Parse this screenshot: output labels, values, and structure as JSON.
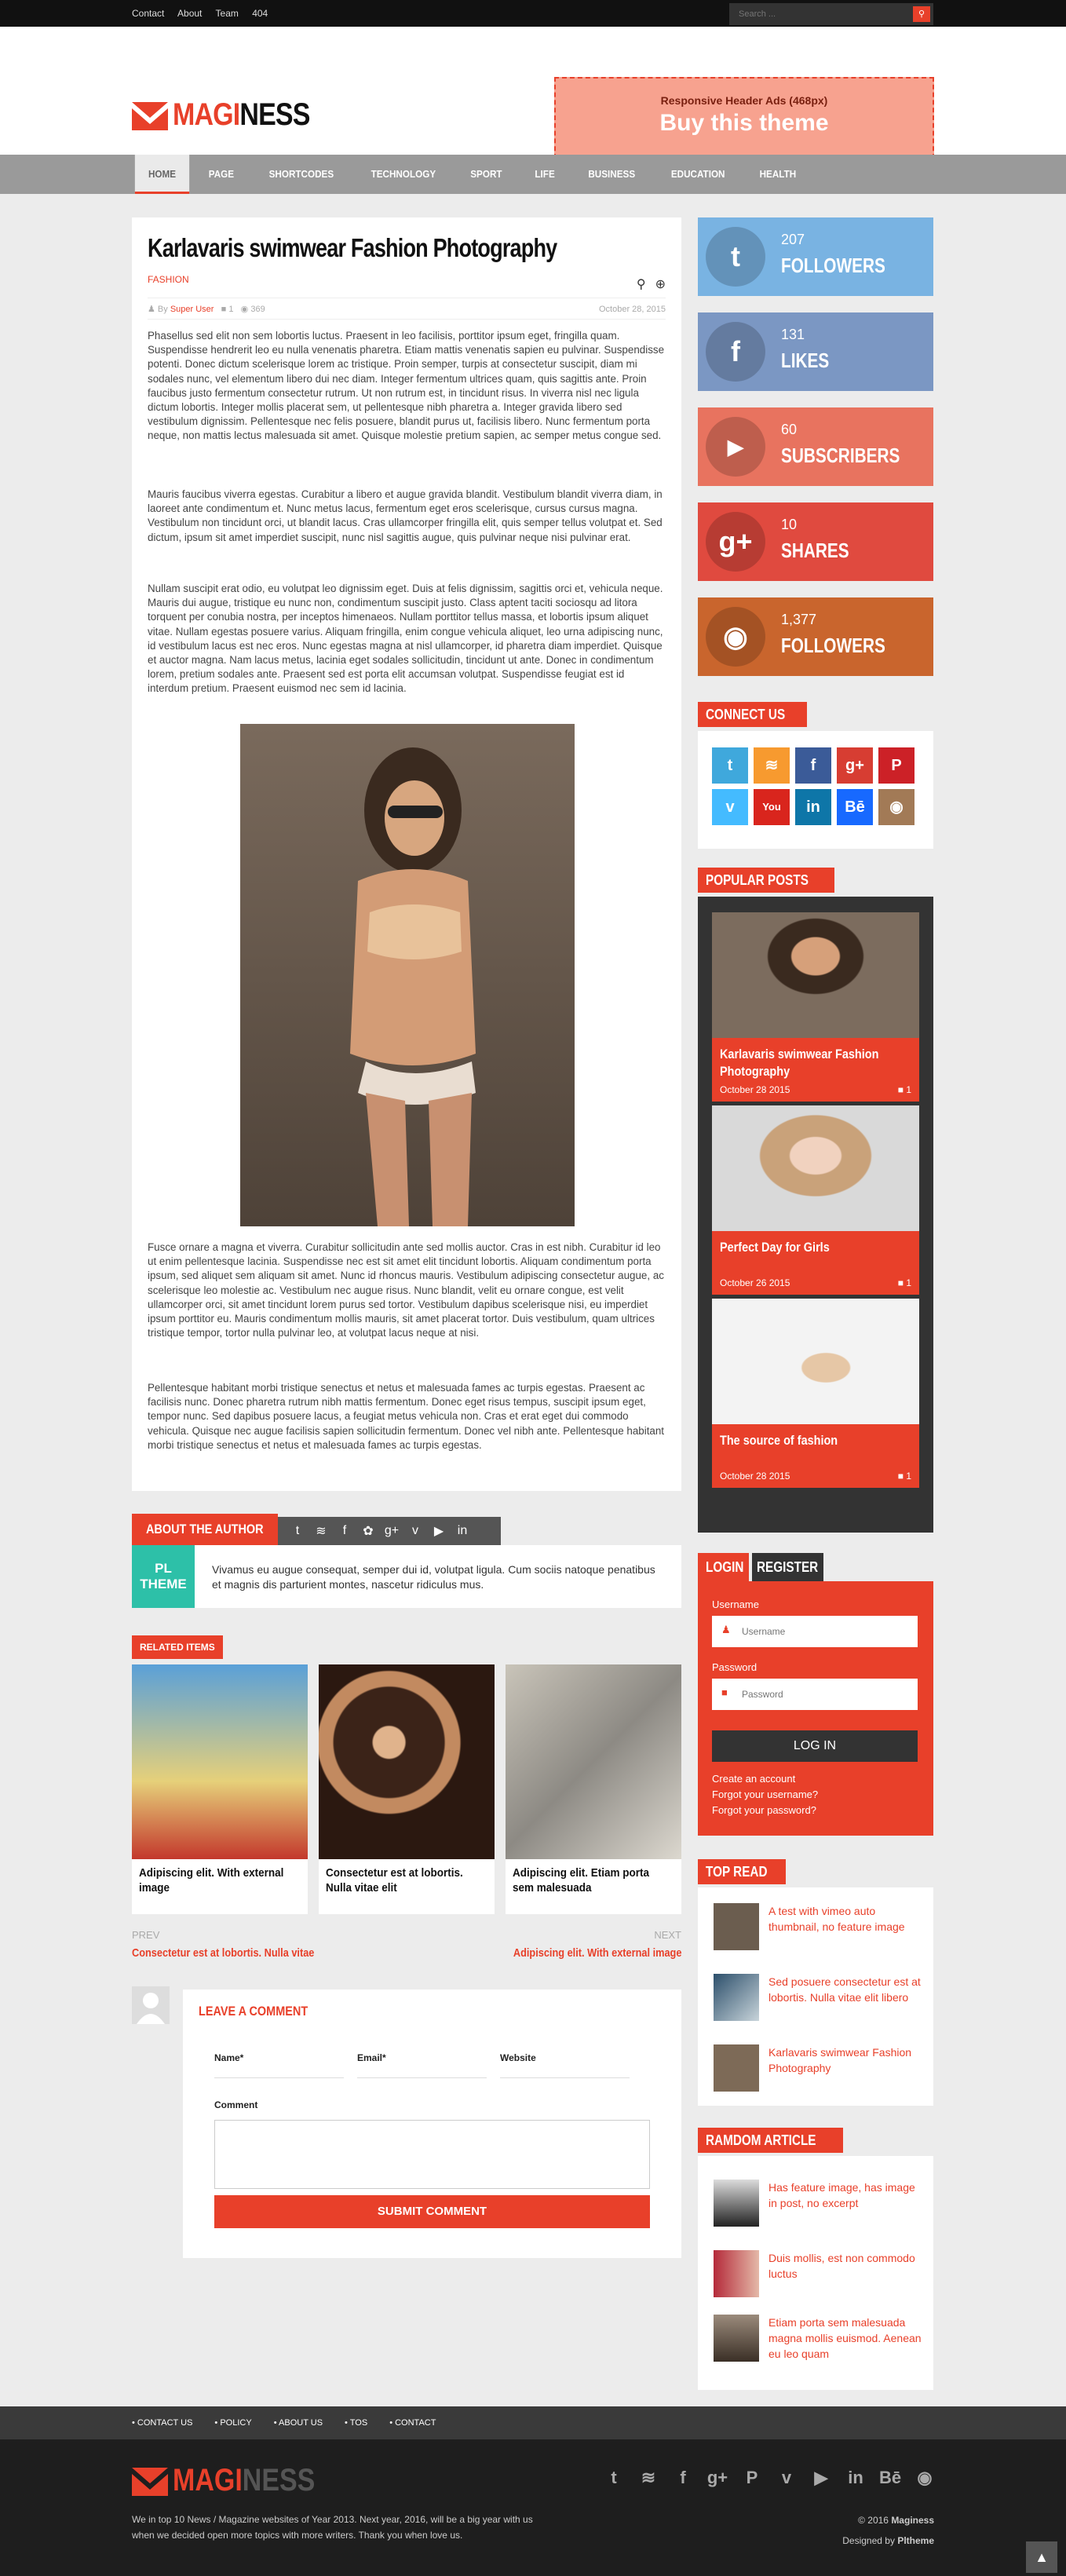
{
  "topbar": {
    "links": [
      "Contact",
      "About",
      "Team",
      "404"
    ],
    "search_placeholder": "Search ...",
    "search_icon": "search-icon"
  },
  "brand": {
    "logo_part1": "MAGI",
    "logo_part2": "NESS",
    "accent": "#e8402a"
  },
  "ad": {
    "line1": "Responsive Header Ads (468px)",
    "line2": "Buy this theme"
  },
  "nav": {
    "items": [
      "HOME",
      "PAGE",
      "SHORTCODES",
      "TECHNOLOGY",
      "SPORT",
      "LIFE",
      "BUSINESS",
      "EDUCATION",
      "HEALTH"
    ]
  },
  "article": {
    "title": "Karlavaris swimwear Fashion Photography",
    "category": "FASHION",
    "by_label": "By",
    "author": "Super User",
    "comments": "1",
    "views": "369",
    "date": "October 28, 2015",
    "paragraphs": [
      "Phasellus sed elit non sem lobortis luctus. Praesent in leo facilisis, porttitor ipsum eget, fringilla quam. Suspendisse hendrerit leo eu nulla venenatis pharetra. Etiam mattis venenatis sapien eu pulvinar. Suspendisse potenti. Donec dictum scelerisque lorem ac tristique. Proin semper, turpis at consectetur suscipit, diam mi sodales nunc, vel elementum libero dui nec diam. Integer fermentum ultrices quam, quis sagittis ante. Proin faucibus justo fermentum consectetur rutrum. Ut non rutrum est, in tincidunt risus. In viverra nisl nec ligula dictum lobortis. Integer mollis placerat sem, ut pellentesque nibh pharetra a. Integer gravida libero sed vestibulum dignissim. Pellentesque nec felis posuere, blandit purus ut, facilisis libero. Nunc fermentum porta neque, non mattis lectus malesuada sit amet. Quisque molestie pretium sapien, ac semper metus congue sed.",
      "Mauris faucibus viverra egestas. Curabitur a libero et augue gravida blandit. Vestibulum blandit viverra diam, in laoreet ante condimentum et. Nunc metus lacus, fermentum eget eros scelerisque, cursus cursus magna. Vestibulum non tincidunt orci, ut blandit lacus. Cras ullamcorper fringilla elit, quis semper tellus volutpat et. Sed dictum, ipsum sit amet imperdiet suscipit, nunc nisl sagittis augue, quis pulvinar neque nisi pulvinar erat.",
      "Nullam suscipit erat odio, eu volutpat leo dignissim eget. Duis at felis dignissim, sagittis orci et, vehicula neque. Mauris dui augue, tristique eu nunc non, condimentum suscipit justo. Class aptent taciti sociosqu ad litora torquent per conubia nostra, per inceptos himenaeos. Nullam porttitor tellus massa, et lobortis ipsum aliquet vitae. Nullam egestas posuere varius. Aliquam fringilla, enim congue vehicula aliquet, leo urna adipiscing nunc, id vestibulum lacus est nec eros. Nunc egestas magna at nisl ullamcorper, id pharetra diam imperdiet. Quisque et auctor magna. Nam lacus metus, lacinia eget sodales sollicitudin, tincidunt ut ante. Donec in condimentum lorem, pretium sodales ante. Praesent sed est porta elit accumsan volutpat. Suspendisse feugiat est id interdum pretium. Praesent euismod nec sem id lacinia.",
      "Fusce ornare a magna et viverra. Curabitur sollicitudin ante sed mollis auctor. Cras in est nibh. Curabitur id leo ut enim pellentesque lacinia. Suspendisse nec est sit amet elit tincidunt lobortis. Aliquam condimentum porta ipsum, sed aliquet sem aliquam sit amet. Nunc id rhoncus mauris. Vestibulum adipiscing consectetur augue, ac scelerisque leo molestie ac. Vestibulum nec augue risus. Nunc blandit, velit eu ornare congue, est velit ullamcorper orci, sit amet tincidunt lorem purus sed tortor. Vestibulum dapibus scelerisque nisi, eu imperdiet ipsum porttitor eu. Mauris condimentum mollis mauris, sit amet placerat tortor. Duis vestibulum, quam ultrices tristique tempor, tortor nulla pulvinar leo, at volutpat lacus neque at nisi.",
      "Pellentesque habitant morbi tristique senectus et netus et malesuada fames ac turpis egestas. Praesent ac facilisis nunc. Donec pharetra rutrum nibh mattis fermentum. Donec eget risus tempus, suscipit ipsum eget, tempor nunc. Sed dapibus posuere lacus, a feugiat metus vehicula non. Cras et erat eget dui commodo vehicula. Quisque nec augue facilisis sapien sollicitudin fermentum. Donec vel nibh ante. Pellentesque habitant morbi tristique senectus et netus et malesuada fames ac turpis egestas."
    ]
  },
  "author_box": {
    "title": "ABOUT THE AUTHOR",
    "social_icons": [
      "twitter-icon",
      "rss-icon",
      "facebook-icon",
      "dribbble-icon",
      "google-plus-icon",
      "vimeo-icon",
      "youtube-icon",
      "linkedin-icon"
    ],
    "avatar_line1": "PL",
    "avatar_line2": "THEME",
    "bio": "Vivamus eu augue consequat, semper dui id, volutpat ligula. Cum sociis natoque penatibus et magnis dis parturient montes, nascetur ridiculus mus."
  },
  "related": {
    "title": "RELATED ITEMS",
    "items": [
      {
        "caption": "Adipiscing elit. With external image"
      },
      {
        "caption": "Consectetur est at lobortis. Nulla vitae elit"
      },
      {
        "caption": "Adipiscing elit. Etiam porta sem malesuada"
      }
    ]
  },
  "prevnext": {
    "prev_label": "PREV",
    "prev_link": "Consectetur est at lobortis. Nulla vitae",
    "next_label": "NEXT",
    "next_link": "Adipiscing elit. With external image"
  },
  "comment_form": {
    "title": "LEAVE A COMMENT",
    "name_label": "Name*",
    "email_label": "Email*",
    "website_label": "Website",
    "comment_label": "Comment",
    "submit": "SUBMIT COMMENT"
  },
  "social_counters": [
    {
      "icon": "twitter-icon",
      "count": "207",
      "label": "FOLLOWERS",
      "color": "#79b3e2"
    },
    {
      "icon": "facebook-icon",
      "count": "131",
      "label": "LIKES",
      "color": "#7b97c3"
    },
    {
      "icon": "youtube-icon",
      "count": "60",
      "label": "SUBSCRIBERS",
      "color": "#e8735f"
    },
    {
      "icon": "google-plus-icon",
      "count": "10",
      "label": "SHARES",
      "color": "#e04a3f"
    },
    {
      "icon": "instagram-icon",
      "count": "1,377",
      "label": "FOLLOWERS",
      "color": "#c9652d"
    }
  ],
  "connect": {
    "title": "CONNECT US",
    "icons": [
      {
        "name": "twitter-icon",
        "glyph": "t",
        "color": "#3fa8dc"
      },
      {
        "name": "rss-icon",
        "glyph": "r",
        "color": "#f79a2f"
      },
      {
        "name": "facebook-icon",
        "glyph": "f",
        "color": "#3b5b98"
      },
      {
        "name": "google-plus-icon",
        "glyph": "g+",
        "color": "#d73d32"
      },
      {
        "name": "pinterest-icon",
        "glyph": "P",
        "color": "#cc2127"
      },
      {
        "name": "vimeo-icon",
        "glyph": "v",
        "color": "#44bbff"
      },
      {
        "name": "youtube-icon",
        "glyph": "You",
        "color": "#d9251d"
      },
      {
        "name": "linkedin-icon",
        "glyph": "in",
        "color": "#0e76a8"
      },
      {
        "name": "behance-icon",
        "glyph": "Bē",
        "color": "#1769ff"
      },
      {
        "name": "instagram-icon",
        "glyph": "◙",
        "color": "#a27a56"
      }
    ]
  },
  "popular": {
    "title": "POPULAR POSTS",
    "items": [
      {
        "title": "Karlavaris swimwear Fashion Photography",
        "date": "October 28 2015",
        "comments": "1"
      },
      {
        "title": "Perfect Day for Girls",
        "date": "October 26 2015",
        "comments": "1"
      },
      {
        "title": "The source of fashion",
        "date": "October 28 2015",
        "comments": "1"
      }
    ]
  },
  "login": {
    "tab_login": "LOGIN",
    "tab_register": "REGISTER",
    "username_label": "Username",
    "username_placeholder": "Username",
    "password_label": "Password",
    "password_placeholder": "Password",
    "button": "LOG IN",
    "links": [
      "Create an account",
      "Forgot your username?",
      "Forgot your password?"
    ]
  },
  "top_read": {
    "title": "TOP READ",
    "items": [
      {
        "title": "A test with vimeo auto thumbnail, no feature image"
      },
      {
        "title": "Sed posuere consectetur est at lobortis. Nulla vitae elit libero"
      },
      {
        "title": "Karlavaris swimwear Fashion Photography"
      }
    ]
  },
  "random": {
    "title": "RAMDOM ARTICLE",
    "items": [
      {
        "title": "Has feature image, has image in post, no excerpt"
      },
      {
        "title": "Duis mollis, est non commodo luctus"
      },
      {
        "title": "Etiam porta sem malesuada magna mollis euismod. Aenean eu leo quam"
      }
    ]
  },
  "footer": {
    "nav": [
      "CONTACT US",
      "POLICY",
      "ABOUT US",
      "TOS",
      "CONTACT"
    ],
    "description": "We in top 10 News / Magazine websites of Year 2013. Next year, 2016, will be a big year with us when we decided open more topics with more writers. Thank you when love us.",
    "social_icons": [
      "twitter-icon",
      "rss-icon",
      "facebook-icon",
      "google-plus-icon",
      "pinterest-icon",
      "vimeo-icon",
      "youtube-icon",
      "linkedin-icon",
      "behance-icon",
      "instagram-icon"
    ],
    "copyright_prefix": "© 2016",
    "copyright_brand": "Maginess",
    "designed_prefix": "Designed by",
    "designed_brand": "Pltheme"
  }
}
